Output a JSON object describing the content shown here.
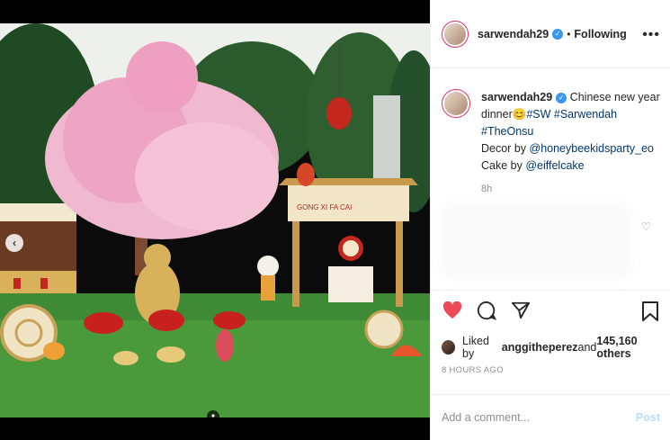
{
  "post": {
    "username": "sarwendah29",
    "follow_status": "Following",
    "separator": "•",
    "more_label": "•••",
    "caption": {
      "username": "sarwendah29",
      "line1": " Chinese new year",
      "line2_prefix": "dinner",
      "emoji": "😊",
      "line2_tags": "#SW #Sarwendah #TheOnsu",
      "line3_text": "Decor by ",
      "line3_link": "@honeybeekidsparty_eo",
      "line4_text": "Cake by ",
      "line4_link": "@eiffelcake"
    },
    "caption_time": "8h",
    "likes": {
      "prefix": "Liked by ",
      "user": "anggitheperez",
      "middle": " and ",
      "count": "145,160 others"
    },
    "time_ago": "8 HOURS AGO",
    "comment": {
      "placeholder": "Add a comment...",
      "post_label": "Post"
    }
  },
  "media": {
    "signboard_text": "GONG XI FA CAI",
    "arrow_label": "‹"
  },
  "colors": {
    "accent": "#3897f0",
    "like_red": "#ed4956",
    "link": "#00376b",
    "muted": "#8e8e8e"
  }
}
